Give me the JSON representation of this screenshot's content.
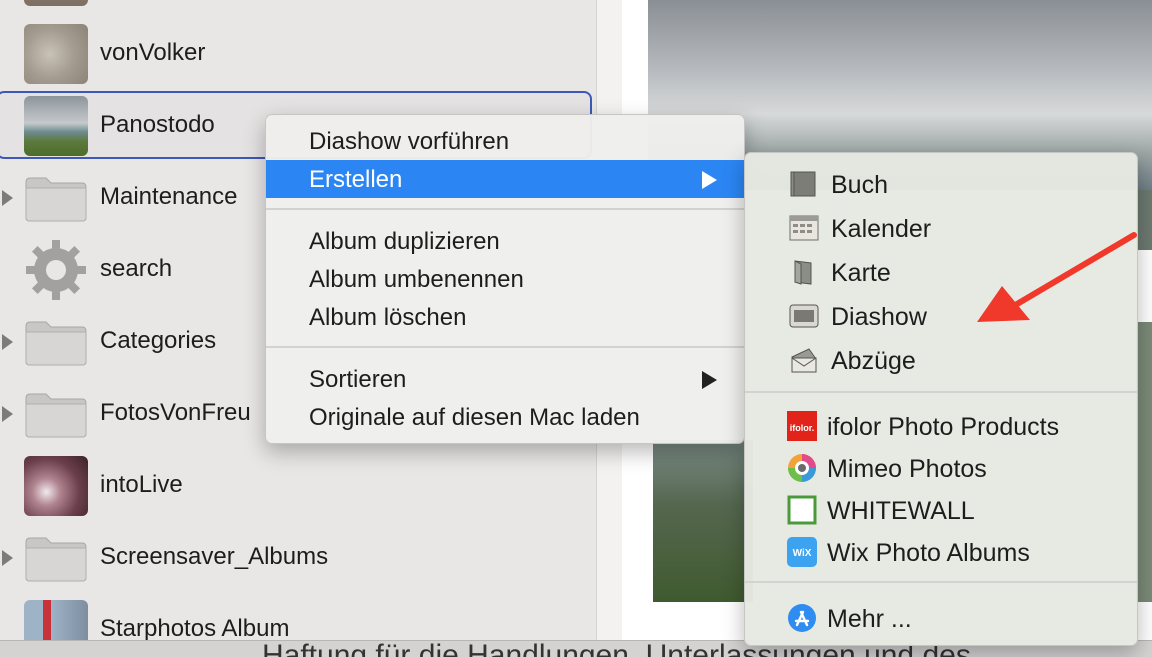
{
  "sidebar": {
    "items": [
      {
        "label": "vonVolker",
        "kind": "album"
      },
      {
        "label": "Panostodo",
        "kind": "album",
        "selected": true
      },
      {
        "label": "Maintenance",
        "kind": "folder"
      },
      {
        "label": "search",
        "kind": "smart-album"
      },
      {
        "label": "Categories",
        "kind": "folder"
      },
      {
        "label": "FotosVonFreu",
        "kind": "folder"
      },
      {
        "label": "intoLive",
        "kind": "album"
      },
      {
        "label": "Screensaver_Albums",
        "kind": "folder"
      },
      {
        "label": "Starphotos Album",
        "kind": "album"
      }
    ]
  },
  "context_menu": {
    "items": [
      {
        "label": "Diashow vorführen"
      },
      {
        "label": "Erstellen",
        "highlighted": true,
        "has_submenu": true
      },
      {
        "label": "Album duplizieren"
      },
      {
        "label": "Album umbenennen"
      },
      {
        "label": "Album löschen"
      },
      {
        "label": "Sortieren",
        "has_submenu": true
      },
      {
        "label": "Originale auf diesen Mac laden"
      }
    ]
  },
  "submenu": {
    "items": [
      {
        "label": "Buch",
        "icon": "book-icon"
      },
      {
        "label": "Kalender",
        "icon": "calendar-icon"
      },
      {
        "label": "Karte",
        "icon": "card-icon"
      },
      {
        "label": "Diashow",
        "icon": "slideshow-icon"
      },
      {
        "label": "Abzüge",
        "icon": "prints-icon"
      }
    ],
    "services": [
      {
        "label": "ifolor Photo Products",
        "icon": "ifolor-icon",
        "logo_text": "ifolor."
      },
      {
        "label": "Mimeo Photos",
        "icon": "mimeo-icon"
      },
      {
        "label": "WHITEWALL",
        "icon": "whitewall-icon"
      },
      {
        "label": "Wix Photo Albums",
        "icon": "wix-icon",
        "logo_text": "WiX"
      }
    ],
    "more": {
      "label": "Mehr ...",
      "icon": "app-store-icon"
    }
  },
  "bottom_text": "Haftung für die Handlungen, Unterlassungen und des",
  "colors": {
    "highlight": "#2b86f4",
    "selection_border": "#3e58b8",
    "annotation_arrow": "#f0392b"
  }
}
